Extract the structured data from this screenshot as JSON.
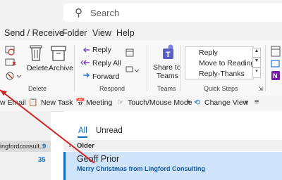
{
  "search": {
    "placeholder": "Search"
  },
  "menu": {
    "items": [
      "Send / Receive",
      "Folder",
      "View",
      "Help"
    ]
  },
  "ribbon": {
    "delete_group": {
      "buttons": [
        "Delete",
        "Archive"
      ],
      "label": "Delete"
    },
    "respond_group": {
      "buttons": [
        "Reply",
        "Reply All",
        "Forward"
      ],
      "label": "Respond"
    },
    "teams_group": {
      "button_line1": "Share to",
      "button_line2": "Teams",
      "label": "Teams"
    },
    "quick_steps_group": {
      "items": [
        "Reply",
        "Move to Reading",
        "Reply-Thanks"
      ],
      "label": "Quick Steps"
    }
  },
  "toolbar": {
    "items": [
      "w Email",
      "New Task",
      "Meeting",
      "Touch/Mouse Mode",
      "Change View"
    ]
  },
  "folders": [
    {
      "name": "ingfordconsult...",
      "count": "9"
    },
    {
      "name": "",
      "count": "35"
    }
  ],
  "message_list": {
    "tabs": [
      "All",
      "Unread"
    ],
    "group_header": "Older",
    "messages": [
      {
        "sender": "Geoff Prior",
        "subject": "Merry Christmas from Lingford Consulting",
        "selected": true
      }
    ]
  },
  "colors": {
    "accent": "#0f6cbd",
    "selected_row": "#cfe4fa",
    "annotation_arrow": "#d42020",
    "teams": "#5b5fc7"
  }
}
